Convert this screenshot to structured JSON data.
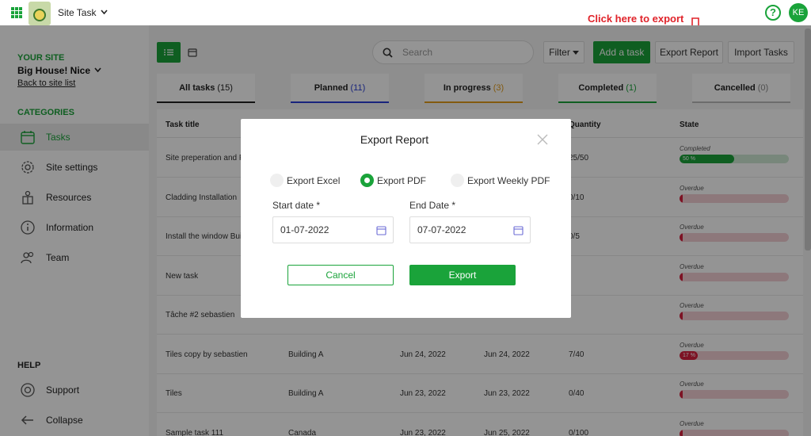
{
  "app": {
    "title": "Site Task"
  },
  "user": {
    "initials": "KE"
  },
  "annotation": {
    "text": "Click here to export report"
  },
  "sidebar": {
    "your_site_label": "YOUR SITE",
    "site_name": "Big House! Nice",
    "back_link": "Back to site list",
    "categories_label": "CATEGORIES",
    "items": [
      {
        "label": "Tasks",
        "icon": "calendar-icon",
        "active": true
      },
      {
        "label": "Site settings",
        "icon": "gear-icon"
      },
      {
        "label": "Resources",
        "icon": "resources-icon"
      },
      {
        "label": "Information",
        "icon": "info-icon"
      },
      {
        "label": "Team",
        "icon": "team-icon"
      }
    ],
    "help_label": "HELP",
    "support_label": "Support",
    "collapse_label": "Collapse"
  },
  "toolbar": {
    "search_placeholder": "Search",
    "filter_label": "Filter",
    "add_label": "Add a task",
    "export_label": "Export Report",
    "import_label": "Import Tasks"
  },
  "tabs": [
    {
      "label": "All tasks",
      "count": "(15)",
      "color": "#222222"
    },
    {
      "label": "Planned",
      "count": "(11)",
      "color": "#2a3fd6"
    },
    {
      "label": "In progress",
      "count": "(3)",
      "color": "#e29b1b"
    },
    {
      "label": "Completed",
      "count": "(1)",
      "color": "#1aa33a"
    },
    {
      "label": "Cancelled",
      "count": "(0)",
      "color": "#bbbbbb"
    }
  ],
  "table": {
    "headers": {
      "title": "Task title",
      "quantity": "Quantity",
      "state": "State"
    },
    "rows": [
      {
        "title": "Site preperation and Fou",
        "area": "",
        "start": "",
        "end": "",
        "qty": "25/50",
        "state": "Completed",
        "progress": 50,
        "progress_label": "50 %"
      },
      {
        "title": "Cladding Installation",
        "area": "",
        "start": "",
        "end": "",
        "qty": "0/10",
        "state": "Overdue",
        "progress": 0,
        "progress_label": ""
      },
      {
        "title": "Install the window Build",
        "area": "",
        "start": "",
        "end": "",
        "qty": "0/5",
        "state": "Overdue",
        "progress": 0,
        "progress_label": ""
      },
      {
        "title": "New task",
        "area": "",
        "start": "",
        "end": "",
        "qty": "",
        "state": "Overdue",
        "progress": 0,
        "progress_label": ""
      },
      {
        "title": "Tâche #2 sebastien",
        "area": "",
        "start": "",
        "end": "",
        "qty": "",
        "state": "Overdue",
        "progress": 0,
        "progress_label": ""
      },
      {
        "title": "Tiles copy by sebastien",
        "area": "Building A",
        "start": "Jun 24, 2022",
        "end": "Jun 24, 2022",
        "qty": "7/40",
        "state": "Overdue",
        "progress": 17,
        "progress_label": "17 %"
      },
      {
        "title": "Tiles",
        "area": "Building A",
        "start": "Jun 23, 2022",
        "end": "Jun 23, 2022",
        "qty": "0/40",
        "state": "Overdue",
        "progress": 0,
        "progress_label": ""
      },
      {
        "title": "Sample task 111",
        "area": "Canada",
        "start": "Jun 23, 2022",
        "end": "Jun 25, 2022",
        "qty": "0/100",
        "state": "Overdue",
        "progress": 0,
        "progress_label": ""
      }
    ]
  },
  "modal": {
    "title": "Export Report",
    "options": [
      {
        "label": "Export Excel",
        "selected": false
      },
      {
        "label": "Export PDF",
        "selected": true
      },
      {
        "label": "Export Weekly PDF",
        "selected": false
      }
    ],
    "start_label": "Start date *",
    "start_value": "01-07-2022",
    "end_label": "End Date *",
    "end_value": "07-07-2022",
    "cancel_label": "Cancel",
    "export_label": "Export"
  },
  "colors": {
    "accent": "#1aa33a",
    "annotation": "#e0232a",
    "overdue": "#d7213f"
  }
}
